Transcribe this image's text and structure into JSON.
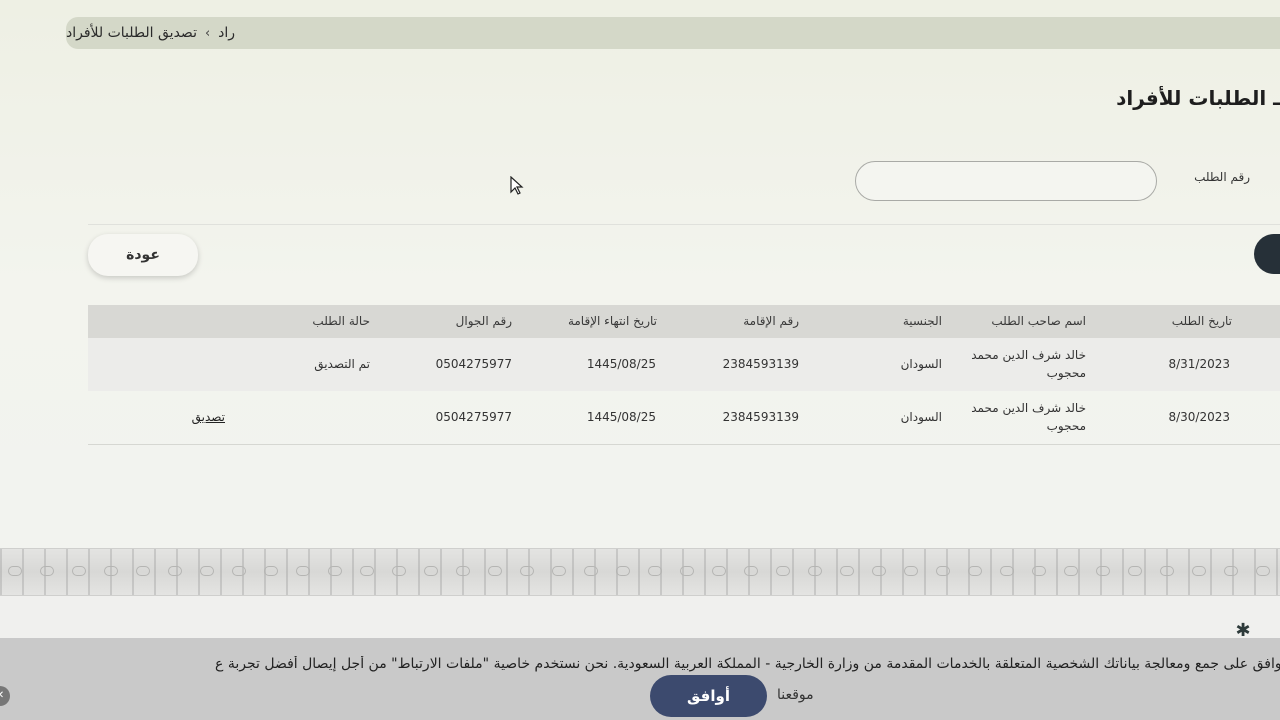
{
  "breadcrumb": {
    "parent": "راد",
    "separator": "›",
    "current": "تصديق الطلبات للأفراد"
  },
  "page_title": "ـ الطلبات للأفراد",
  "search": {
    "label": "رقم الطلب",
    "value": "",
    "placeholder": ""
  },
  "back_button": "عودة",
  "table": {
    "headers": {
      "date": "تاريخ الطلب",
      "name": "اسم صاحب الطلب",
      "nationality": "الجنسية",
      "iqama": "رقم الإقامة",
      "iqama_expiry": "تاريخ انتهاء الإقامة",
      "mobile": "رقم الجوال",
      "status": "حالة الطلب"
    },
    "rows": [
      {
        "date": "8/31/2023",
        "name": "خالد شرف الدين محمد محجوب",
        "nationality": "السودان",
        "iqama": "2384593139",
        "iqama_expiry": "1445/08/25",
        "mobile": "0504275977",
        "status": "تم التصديق",
        "action": ""
      },
      {
        "date": "8/30/2023",
        "name": "خالد شرف الدين محمد محجوب",
        "nationality": "السودان",
        "iqama": "2384593139",
        "iqama_expiry": "1445/08/25",
        "mobile": "0504275977",
        "status": "",
        "action": "تصديق"
      }
    ]
  },
  "cookie_bar": {
    "text": "توافق على جمع ومعالجة بياناتك الشخصية المتعلقة بالخدمات المقدمة من وزارة الخارجية - المملكة العربية السعودية. نحن نستخدم خاصية \"ملفات الارتباط\" من أجل إيصال أفضل تجربة ع",
    "site_link": "موقعنا",
    "agree_button": "أوافق"
  },
  "colors": {
    "breadcrumb_bg": "#d4d8c8",
    "table_header_bg": "#d8d8d4",
    "agree_button_bg": "#3c4a6e",
    "cookie_bar_bg": "#c9c9c9"
  }
}
